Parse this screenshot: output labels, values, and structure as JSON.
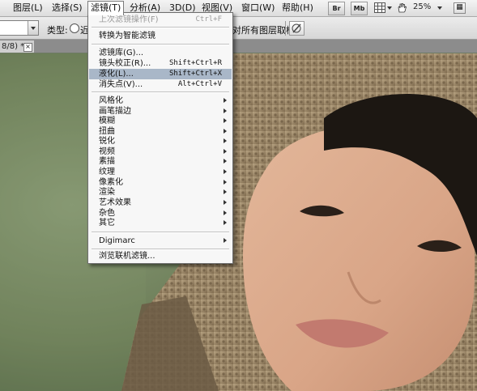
{
  "menubar": {
    "items": [
      {
        "label": "图层(L)"
      },
      {
        "label": "选择(S)"
      },
      {
        "label": "滤镜(T)"
      },
      {
        "label": "分析(A)"
      },
      {
        "label": "3D(D)"
      },
      {
        "label": "视图(V)"
      },
      {
        "label": "窗口(W)"
      },
      {
        "label": "帮助(H)"
      }
    ],
    "bridge_label": "Br",
    "minibridge_label": "Mb",
    "zoom": "25%"
  },
  "options": {
    "type_label": "类型:",
    "radio_label": "近",
    "sample_all_layers": "对所有图层取样"
  },
  "document": {
    "tab_label": "8/8) *",
    "close_label": "×"
  },
  "filter_menu": {
    "last_filter": {
      "label": "上次滤镜操作(F)",
      "shortcut": "Ctrl+F"
    },
    "smart_filter": {
      "label": "转换为智能滤镜"
    },
    "gallery": {
      "label": "滤镜库(G)..."
    },
    "lens_correction": {
      "label": "镜头校正(R)...",
      "shortcut": "Shift+Ctrl+R"
    },
    "liquify": {
      "label": "液化(L)...",
      "shortcut": "Shift+Ctrl+X"
    },
    "vanishing_point": {
      "label": "消失点(V)...",
      "shortcut": "Alt+Ctrl+V"
    },
    "submenus": [
      {
        "label": "风格化"
      },
      {
        "label": "画笔描边"
      },
      {
        "label": "模糊"
      },
      {
        "label": "扭曲"
      },
      {
        "label": "锐化"
      },
      {
        "label": "视频"
      },
      {
        "label": "素描"
      },
      {
        "label": "纹理"
      },
      {
        "label": "像素化"
      },
      {
        "label": "渲染"
      },
      {
        "label": "艺术效果"
      },
      {
        "label": "杂色"
      },
      {
        "label": "其它"
      }
    ],
    "digimarc": {
      "label": "Digimarc"
    },
    "browse_online": {
      "label": "浏览联机滤镜..."
    }
  }
}
